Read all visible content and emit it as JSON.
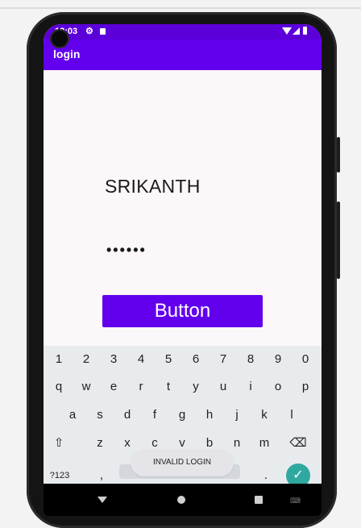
{
  "status_bar": {
    "time": "12:03",
    "icons": [
      "gear-icon",
      "sd-card-icon",
      "wifi-icon",
      "signal-icon",
      "battery-icon"
    ]
  },
  "app_bar": {
    "title": "login"
  },
  "form": {
    "username_value": "SRIKANTH",
    "password_value": "••••••",
    "button_label": "Button"
  },
  "keyboard": {
    "number_row": [
      "1",
      "2",
      "3",
      "4",
      "5",
      "6",
      "7",
      "8",
      "9",
      "0"
    ],
    "row1": [
      "q",
      "w",
      "e",
      "r",
      "t",
      "y",
      "u",
      "i",
      "o",
      "p"
    ],
    "row2": [
      "a",
      "s",
      "d",
      "f",
      "g",
      "h",
      "j",
      "k",
      "l"
    ],
    "row3": [
      "z",
      "x",
      "c",
      "v",
      "b",
      "n",
      "m"
    ],
    "shift_icon": "⇧",
    "backspace_icon": "⌫",
    "symbols_label": "?123",
    "comma_label": ",",
    "period_label": ".",
    "enter_icon": "✓"
  },
  "toast": {
    "message": "INVALID LOGIN"
  },
  "colors": {
    "primary": "#6200ee",
    "status_bar": "#5c00d9",
    "enter_key": "#2fa8a0"
  }
}
